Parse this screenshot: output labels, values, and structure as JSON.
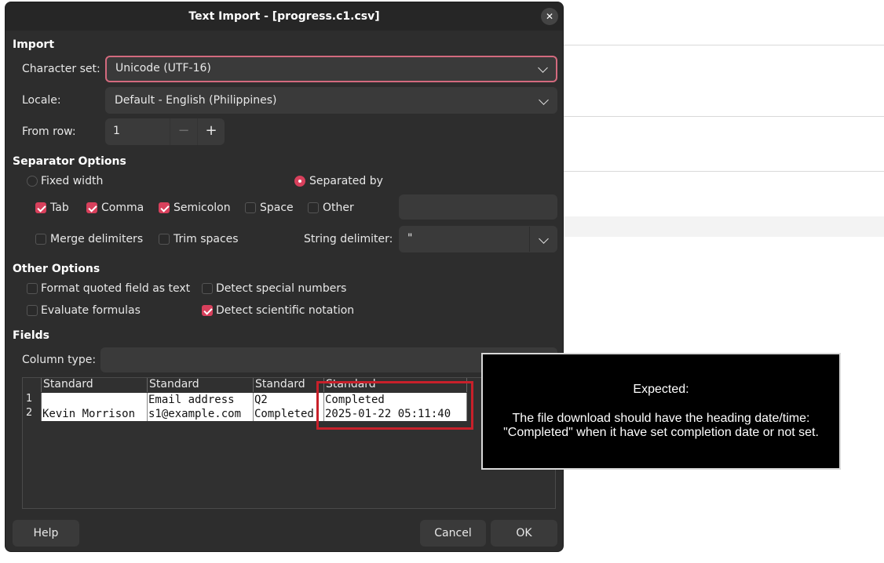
{
  "window": {
    "title": "Text Import - [progress.c1.csv]",
    "close_glyph": "✕"
  },
  "import": {
    "heading": "Import",
    "charset_label": "Character set:",
    "charset_value": "Unicode (UTF-16)",
    "locale_label": "Locale:",
    "locale_value": "Default - English (Philippines)",
    "from_row_label": "From row:",
    "from_row_value": "1",
    "minus": "−",
    "plus": "+"
  },
  "separator": {
    "heading": "Separator Options",
    "fixed_width": "Fixed width",
    "separated_by": "Separated by",
    "tab": "Tab",
    "comma": "Comma",
    "semicolon": "Semicolon",
    "space": "Space",
    "other": "Other",
    "merge": "Merge delimiters",
    "trim": "Trim spaces",
    "string_delim_label": "String delimiter:",
    "string_delim_value": "\""
  },
  "other_options": {
    "heading": "Other Options",
    "format_quoted": "Format quoted field as text",
    "detect_special": "Detect special numbers",
    "evaluate_formulas": "Evaluate formulas",
    "detect_scientific": "Detect scientific notation"
  },
  "fields": {
    "heading": "Fields",
    "column_type_label": "Column type:",
    "headers": [
      "Standard",
      "Standard",
      "Standard",
      "Standard"
    ],
    "row_numbers": [
      "1",
      "2"
    ],
    "rows": [
      [
        "",
        "Email address",
        "Q2",
        "Completed"
      ],
      [
        "Kevin Morrison",
        "s1@example.com",
        "Completed",
        "2025-01-22 05:11:40"
      ]
    ]
  },
  "buttons": {
    "help": "Help",
    "cancel": "Cancel",
    "ok": "OK"
  },
  "annotation": {
    "heading": "Expected:",
    "body": "The file download should have the heading date/time: \"Completed\" when it have set completion date or not set."
  }
}
